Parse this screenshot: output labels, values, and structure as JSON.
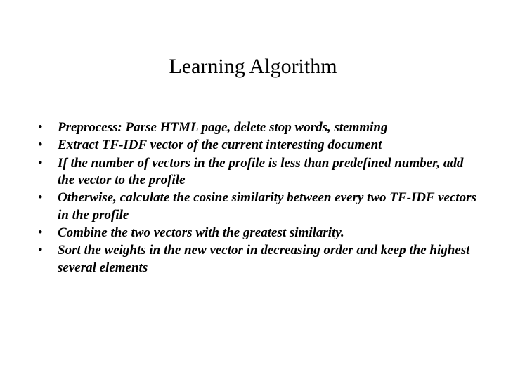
{
  "slide": {
    "title": "Learning Algorithm",
    "bullets": [
      "Preprocess: Parse HTML page, delete stop words, stemming",
      "Extract TF-IDF vector of the current interesting document",
      "If the number of vectors in the profile is less than predefined number, add the vector to the profile",
      "Otherwise, calculate the cosine similarity between every two TF-IDF vectors in the profile",
      "Combine the two vectors with the greatest similarity.",
      "Sort the weights in the new vector in decreasing order and keep the highest several elements"
    ]
  }
}
